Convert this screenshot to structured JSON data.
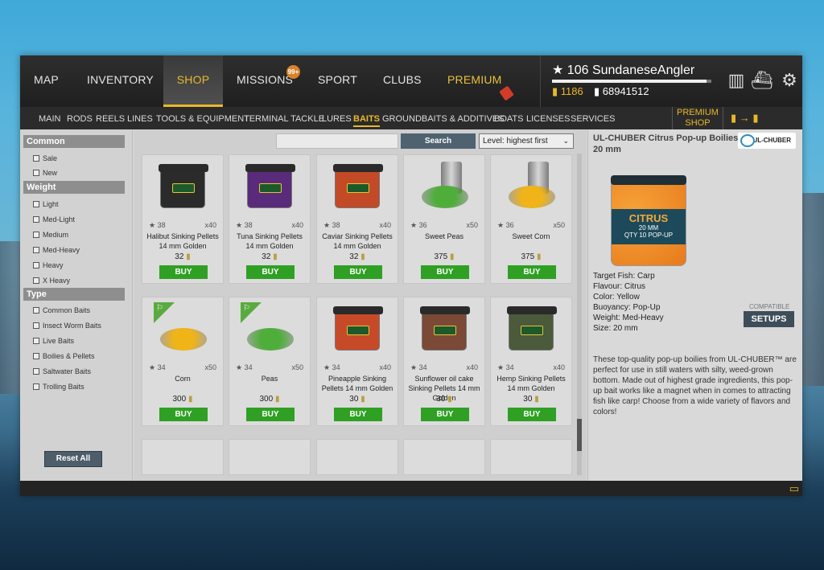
{
  "topnav": {
    "tabs": [
      "MAP",
      "INVENTORY",
      "SHOP",
      "MISSIONS",
      "SPORT",
      "CLUBS",
      "PREMIUM"
    ],
    "missions_badge": "99+"
  },
  "profile": {
    "level": "106",
    "name": "SundaneseAngler",
    "gold": "1186",
    "silver": "68941512",
    "xp_fraction": 0.97
  },
  "subnav": {
    "items": [
      "MAIN",
      "RODS",
      "REELS",
      "LINES",
      "TOOLS & EQUIPMENT",
      "TERMINAL TACKLE",
      "LURES",
      "BAITS",
      "GROUNDBAITS & ADDITIVES",
      "BOATS",
      "LICENSES",
      "SERVICES"
    ],
    "premium_shop": "PREMIUM SHOP"
  },
  "filters": {
    "common": {
      "title": "Common",
      "items": [
        "Sale",
        "New"
      ]
    },
    "weight": {
      "title": "Weight",
      "items": [
        "Light",
        "Med-Light",
        "Medium",
        "Med-Heavy",
        "Heavy",
        "X Heavy"
      ]
    },
    "type": {
      "title": "Type",
      "items": [
        "Common Baits",
        "Insect Worm Baits",
        "Live Baits",
        "Boilies & Pellets",
        "Saltwater Baits",
        "Trolling Baits"
      ]
    },
    "reset": "Reset All"
  },
  "search": {
    "button": "Search",
    "placeholder": "",
    "sort": "Level: highest first"
  },
  "products": [
    {
      "name": "Halibut Sinking Pellets 14 mm Golden",
      "rating": "38",
      "qty": "x40",
      "price": "32",
      "buy": "BUY",
      "color": "#2b2b2b"
    },
    {
      "name": "Tuna Sinking Pellets 14 mm Golden",
      "rating": "38",
      "qty": "x40",
      "price": "32",
      "buy": "BUY",
      "color": "#5a2b7a"
    },
    {
      "name": "Caviar Sinking Pellets 14 mm Golden",
      "rating": "38",
      "qty": "x40",
      "price": "32",
      "buy": "BUY",
      "color": "#c24a26"
    },
    {
      "name": "Sweet Peas",
      "rating": "36",
      "qty": "x50",
      "price": "375",
      "buy": "BUY",
      "color": "#4fae3a"
    },
    {
      "name": "Sweet Corn",
      "rating": "36",
      "qty": "x50",
      "price": "375",
      "buy": "BUY",
      "color": "#f0b418"
    },
    {
      "name": "Corn",
      "rating": "34",
      "qty": "x50",
      "price": "300",
      "buy": "BUY",
      "color": "#f0b418"
    },
    {
      "name": "Peas",
      "rating": "34",
      "qty": "x50",
      "price": "300",
      "buy": "BUY",
      "color": "#4fae3a"
    },
    {
      "name": "Pineapple Sinking Pellets 14 mm Golden",
      "rating": "34",
      "qty": "x40",
      "price": "30",
      "buy": "BUY",
      "color": "#c74a28"
    },
    {
      "name": "Sunflower oil cake Sinking Pellets 14 mm Golden",
      "rating": "34",
      "qty": "x40",
      "price": "30",
      "buy": "BUY",
      "color": "#7a4a36"
    },
    {
      "name": "Hemp Sinking Pellets 14 mm Golden",
      "rating": "34",
      "qty": "x40",
      "price": "30",
      "buy": "BUY",
      "color": "#4a5a3a"
    }
  ],
  "details": {
    "title": "UL-CHUBER Citrus Pop-up Boilies 20 mm",
    "brand": "UL-CHUBER",
    "jar_title": "CITRUS",
    "jar_sub": "20 MM",
    "jar_meta": "QTY 10   POP-UP",
    "specs": [
      "Target Fish: Carp",
      "Flavour: Citrus",
      "Color: Yellow",
      "Buoyancy: Pop-Up",
      "Weight: Med-Heavy",
      "Size: 20 mm"
    ],
    "compatible": "COMPATIBLE",
    "setups": "SETUPS",
    "description": "These top-quality pop-up boilies from UL-CHUBER™ are perfect for use in still waters with silty, weed-grown bottom. Made out of highest grade ingredients, this pop-up bait works like a magnet when in comes to attracting fish like carp! Choose from a wide variety of flavors and colors!"
  }
}
